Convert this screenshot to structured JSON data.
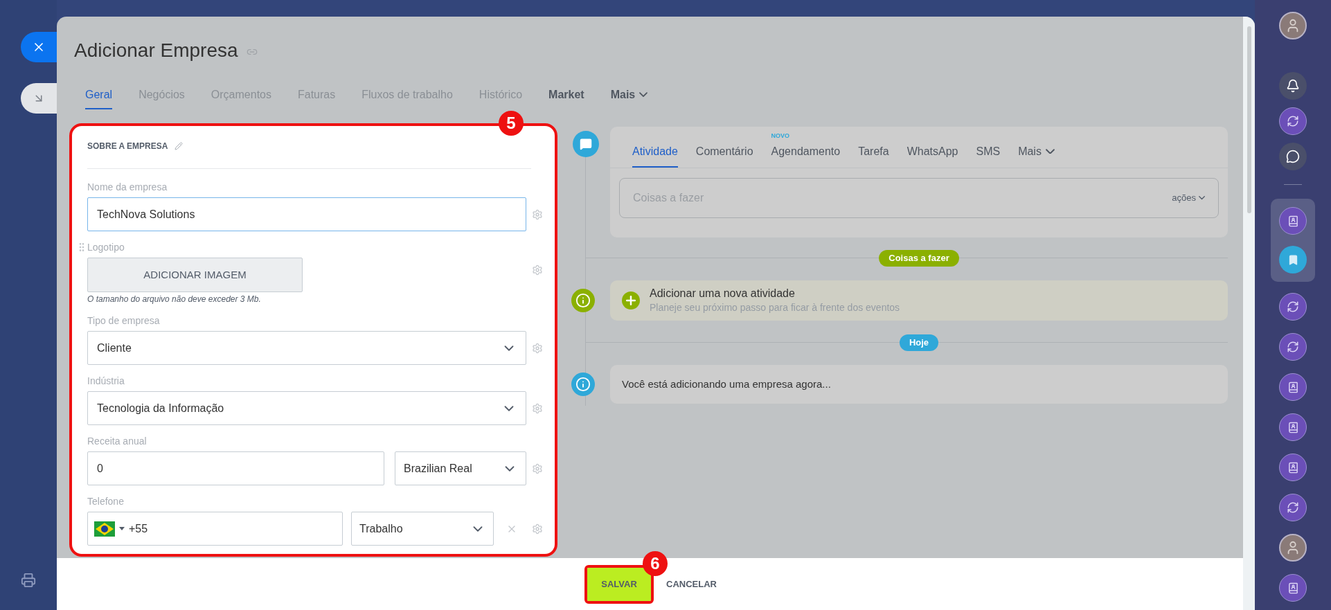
{
  "title": "Adicionar Empresa",
  "tabs": [
    {
      "label": "Geral",
      "selected": true,
      "kind": "section"
    },
    {
      "label": "Negócios",
      "selected": false,
      "kind": "section"
    },
    {
      "label": "Orçamentos",
      "selected": false,
      "kind": "section"
    },
    {
      "label": "Faturas",
      "selected": false,
      "kind": "section"
    },
    {
      "label": "Fluxos de trabalho",
      "selected": false,
      "kind": "section"
    },
    {
      "label": "Histórico",
      "selected": false,
      "kind": "section"
    },
    {
      "label": "Market",
      "selected": false,
      "kind": "app"
    },
    {
      "label": "Mais",
      "selected": false,
      "kind": "menu"
    }
  ],
  "form": {
    "heading": "SOBRE A EMPRESA",
    "annotation": "5",
    "fields": [
      {
        "kind": "text",
        "label": "Nome da empresa",
        "value": "TechNova Solutions",
        "focused": true
      },
      {
        "kind": "image",
        "label": "Logotipo",
        "button": "ADICIONAR IMAGEM",
        "note": "O tamanho do arquivo não deve exceder 3 Mb.",
        "focused": false
      },
      {
        "kind": "select",
        "label": "Tipo de empresa",
        "value": "Cliente",
        "focused": false
      },
      {
        "kind": "select",
        "label": "Indústria",
        "value": "Tecnologia da Informação",
        "focused": false
      },
      {
        "kind": "money",
        "label": "Receita anual",
        "value": "0",
        "currency": "Brazilian Real",
        "focused": false
      },
      {
        "kind": "phone",
        "label": "Telefone",
        "value": "+55",
        "type": "Trabalho",
        "focused": false
      }
    ]
  },
  "timeline": {
    "tabs": [
      {
        "label": "Atividade",
        "selected": true,
        "kind": "tab"
      },
      {
        "label": "Comentário",
        "selected": false,
        "kind": "tab"
      },
      {
        "label": "Agendamento",
        "selected": false,
        "kind": "tab",
        "badge": "NOVO"
      },
      {
        "label": "Tarefa",
        "selected": false,
        "kind": "tab"
      },
      {
        "label": "WhatsApp",
        "selected": false,
        "kind": "tab"
      },
      {
        "label": "SMS",
        "selected": false,
        "kind": "tab"
      },
      {
        "label": "Mais",
        "selected": false,
        "kind": "menu"
      }
    ],
    "placeholder": "Coisas a fazer",
    "actions": "ações",
    "entries": [
      {
        "kind": "divider",
        "label": "Coisas a fazer",
        "color": "#8bb000"
      },
      {
        "kind": "add",
        "title": "Adicionar uma nova atividade",
        "subtitle": "Planeje seu próximo passo para ficar à frente dos eventos"
      },
      {
        "kind": "divider",
        "label": "Hoje",
        "color": "#2fa8d9"
      },
      {
        "kind": "note",
        "text": "Você está adicionando uma empresa agora..."
      }
    ]
  },
  "footer": {
    "annotation": "6",
    "buttons": [
      {
        "label": "SALVAR",
        "kind": "primary"
      },
      {
        "label": "CANCELAR",
        "kind": "link"
      }
    ]
  },
  "sidebar": {
    "top": [
      {
        "kind": "avatar"
      },
      {
        "kind": "bell"
      },
      {
        "kind": "copilot"
      },
      {
        "kind": "chat"
      }
    ],
    "pinned": [
      {
        "kind": "contact"
      },
      {
        "kind": "bookmark"
      }
    ],
    "apps": [
      {
        "kind": "copilot"
      },
      {
        "kind": "copilot"
      },
      {
        "kind": "contact"
      },
      {
        "kind": "contact"
      },
      {
        "kind": "contact"
      },
      {
        "kind": "copilot"
      },
      {
        "kind": "avatar"
      },
      {
        "kind": "contact"
      }
    ]
  }
}
